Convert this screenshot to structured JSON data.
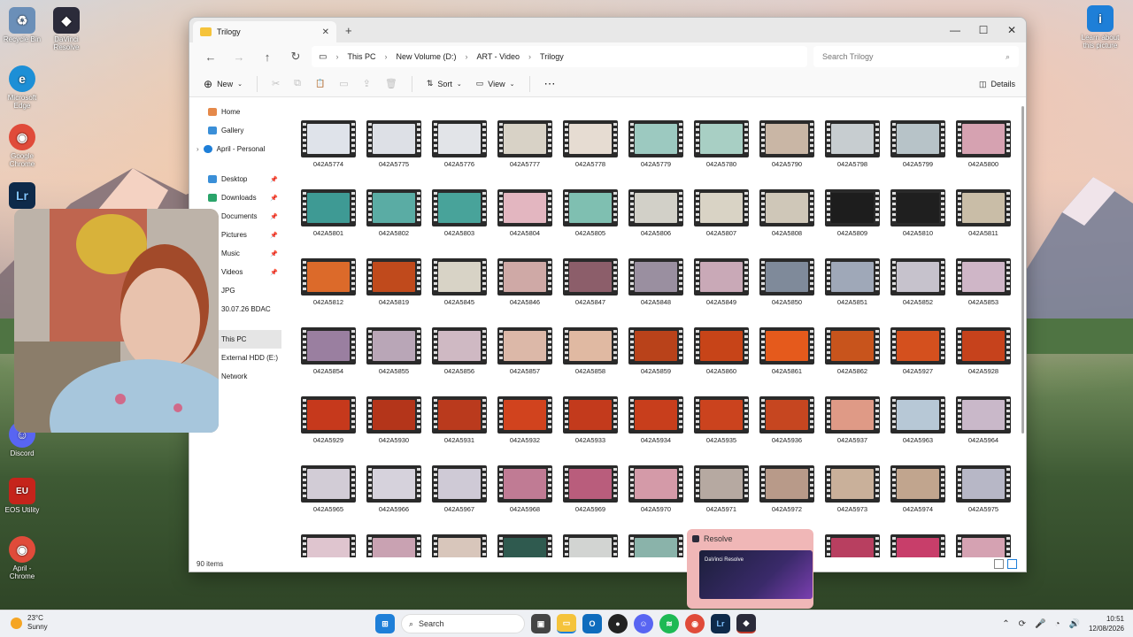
{
  "desktop": {
    "icons": [
      {
        "label": "Recycle Bin",
        "color": "#6b8fb8",
        "glyph": "♻"
      },
      {
        "label": "DaVinci Resolve",
        "color": "#2b2b3a",
        "glyph": "◆"
      },
      {
        "label": "Microsoft Edge",
        "color": "#1d8fd6",
        "glyph": "e"
      },
      {
        "label": "Google Chrome",
        "color": "#e04b3a",
        "glyph": "◉"
      },
      {
        "label": "Discord",
        "color": "#5865f2",
        "glyph": "☺"
      },
      {
        "label": "EOS Utility",
        "color": "#c5241b",
        "glyph": "EU"
      },
      {
        "label": "April - Chrome",
        "color": "#e04b3a",
        "glyph": "◉"
      },
      {
        "label": "Learn about this picture",
        "color": "#1e7fd8",
        "glyph": "i"
      }
    ]
  },
  "window": {
    "tab_title": "Trilogy",
    "breadcrumb": [
      "This PC",
      "New Volume (D:)",
      "ART - Video",
      "Trilogy"
    ],
    "search_placeholder": "Search Trilogy",
    "toolbar": {
      "new": "New",
      "sort": "Sort",
      "view": "View",
      "details": "Details"
    },
    "sidebar": {
      "top": [
        "Home",
        "Gallery",
        "April - Personal"
      ],
      "quick": [
        "Desktop",
        "Downloads",
        "Documents",
        "Pictures",
        "Music",
        "Videos",
        "JPG",
        "30.07.26 BDAC"
      ],
      "drives": [
        "This PC",
        "External HDD (E:)",
        "Network"
      ]
    },
    "files": [
      [
        "042A5774",
        "042A5775",
        "042A5776",
        "042A5777",
        "042A5778",
        "042A5779",
        "042A5780",
        "042A5790",
        "042A5798",
        "042A5799",
        "042A5800"
      ],
      [
        "042A5801",
        "042A5802",
        "042A5803",
        "042A5804",
        "042A5805",
        "042A5806",
        "042A5807",
        "042A5808",
        "042A5809",
        "042A5810",
        "042A5811"
      ],
      [
        "042A5812",
        "042A5819",
        "042A5845",
        "042A5846",
        "042A5847",
        "042A5848",
        "042A5849",
        "042A5850",
        "042A5851",
        "042A5852",
        "042A5853"
      ],
      [
        "042A5854",
        "042A5855",
        "042A5856",
        "042A5857",
        "042A5858",
        "042A5859",
        "042A5860",
        "042A5861",
        "042A5862",
        "042A5927",
        "042A5928"
      ],
      [
        "042A5929",
        "042A5930",
        "042A5931",
        "042A5932",
        "042A5933",
        "042A5934",
        "042A5935",
        "042A5936",
        "042A5937",
        "042A5963",
        "042A5964"
      ],
      [
        "042A5965",
        "042A5966",
        "042A5967",
        "042A5968",
        "042A5969",
        "042A5970",
        "042A5971",
        "042A5972",
        "042A5973",
        "042A5974",
        "042A5975"
      ]
    ],
    "thumb_colors": [
      [
        "#dfe3ea",
        "#dde0e6",
        "#e2e4e8",
        "#d8d2c6",
        "#e6dcd2",
        "#9cc9c0",
        "#a8cfc4",
        "#c9b6a5",
        "#c7cdd0",
        "#b7c3c8",
        "#d6a2b1"
      ],
      [
        "#3e9a94",
        "#5aaca4",
        "#48a39a",
        "#e3b6c0",
        "#7fbfb1",
        "#d2d0c8",
        "#d9d3c5",
        "#cfc7b8",
        "#1d1d1d",
        "#1f1f1f",
        "#c9bda7"
      ],
      [
        "#dc6a2a",
        "#c04a1c",
        "#d8d3c6",
        "#cfa9a6",
        "#8c5e6a",
        "#9a8fa0",
        "#c9a9b7",
        "#7f8a9a",
        "#9fa8b8",
        "#c6c2cc",
        "#cfb6c7"
      ],
      [
        "#9a7fa0",
        "#b9a6b7",
        "#cfb9c3",
        "#dcb8a8",
        "#e0b9a2",
        "#b9421a",
        "#c74418",
        "#e55a1c",
        "#c8541c",
        "#d4501e",
        "#c6421c"
      ],
      [
        "#c6391c",
        "#b4351a",
        "#ba3a1d",
        "#d1431e",
        "#c33a1c",
        "#c83e1c",
        "#cb431e",
        "#c64620",
        "#df9a86",
        "#b7c8d6",
        "#c9b8c9"
      ],
      [
        "#d2ccd6",
        "#d6d2dc",
        "#cfcad6",
        "#c07b94",
        "#b95d7c",
        "#d49aa8",
        "#b6a9a1",
        "#b89a89",
        "#c9b09a",
        "#c1a58e",
        "#b7b7c6"
      ]
    ],
    "partial_row_colors": [
      "#dfc5cf",
      "#c9a2b2",
      "#d8c6bb",
      "#2f5a4f",
      "#d2d4d2",
      "#8ab3aa",
      "",
      "",
      "#b83f60",
      "#c83e6a",
      "#d5a2b2"
    ],
    "status": "90 items"
  },
  "preview": {
    "title": "Resolve",
    "caption": "DaVinci Resolve"
  },
  "taskbar": {
    "weather_temp": "23°C",
    "weather_cond": "Sunny",
    "search": "Search",
    "time": "10:51",
    "date": "12/08/2026"
  }
}
